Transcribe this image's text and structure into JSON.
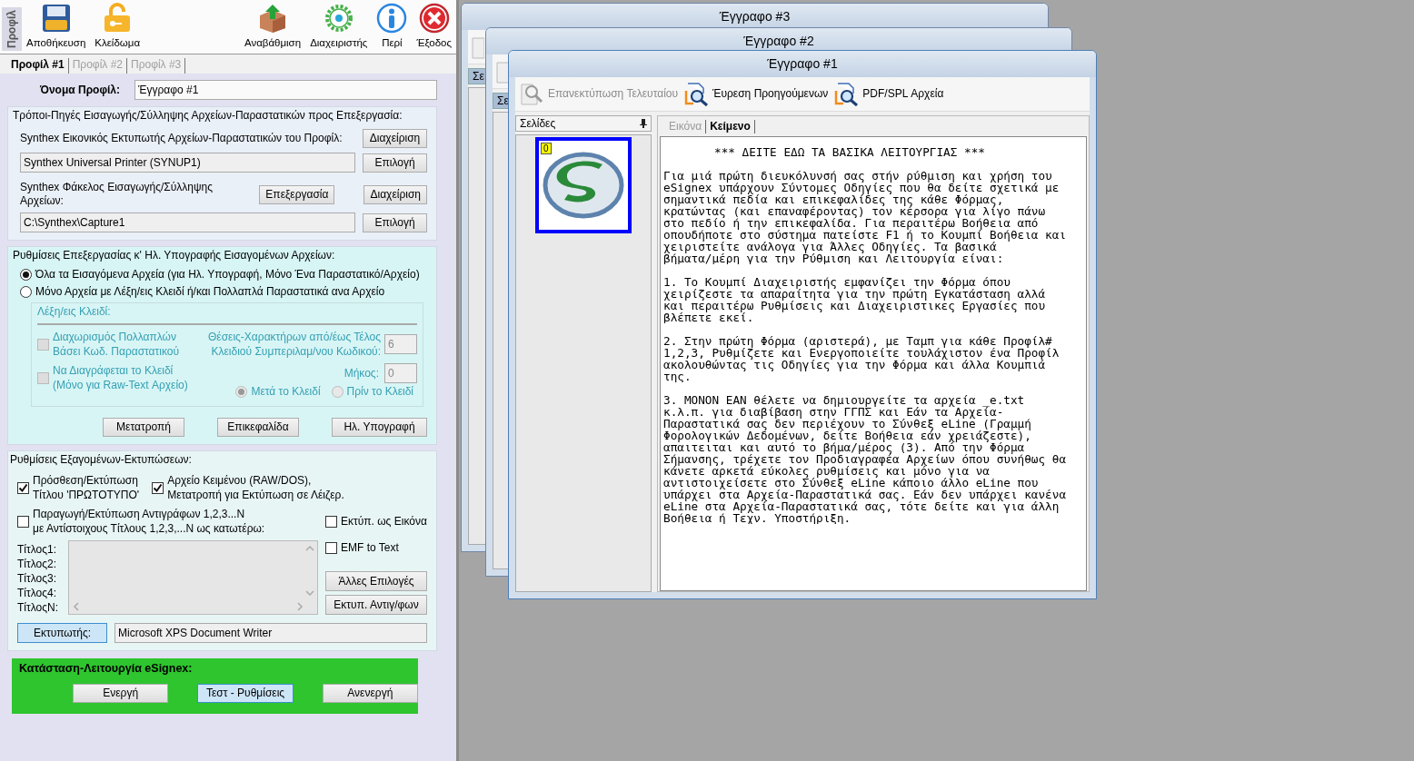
{
  "toolbar": {
    "side_label": "Προφίλ",
    "items": [
      {
        "label": "Αποθήκευση",
        "kind": "save"
      },
      {
        "label": "Κλείδωμα",
        "kind": "unlock"
      },
      {
        "label": "Αναβάθμιση",
        "kind": "update"
      },
      {
        "label": "Διαχειριστής",
        "kind": "admin"
      },
      {
        "label": "Περί",
        "kind": "about"
      },
      {
        "label": "Έξοδος",
        "kind": "exit"
      }
    ]
  },
  "tabs": [
    {
      "label": "Προφίλ #1",
      "selected": true
    },
    {
      "label": "Προφίλ #2",
      "selected": false
    },
    {
      "label": "Προφίλ #3",
      "selected": false
    }
  ],
  "profile_name": {
    "label": "Όνομα Προφίλ:",
    "value": "Έγγραφο  #1"
  },
  "sources": {
    "title": "Τρόποι-Πηγές Εισαγωγής/Σύλληψης Αρχείων-Παραστατικών προς Επεξεργασία:",
    "printer": {
      "label": "Synthex Εικονικός Εκτυπωτής Αρχείων-Παραστατικών του Προφίλ:",
      "manage_button": "Διαχείριση",
      "value": "Synthex Universal Printer (SYNUP1)",
      "select_button": "Επιλογή"
    },
    "folder": {
      "label": "Synthex Φάκελος Εισαγωγής/Σύλληψης Αρχείων:",
      "edit_button": "Επεξεργασία",
      "manage_button": "Διαχείριση",
      "value": "C:\\Synthex\\Capture1",
      "select_button": "Επιλογή"
    }
  },
  "processing": {
    "title": "Ρυθμίσεις Επεξεργασίας κ' Ηλ. Υπογραφής Εισαγομένων Αρχείων:",
    "modes": [
      {
        "label": "Όλα τα Εισαγόμενα Αρχεία (για Ηλ. Υπογραφή, Μόνο Ένα Παραστατικό/Αρχείο)",
        "selected": true
      },
      {
        "label": "Μόνο Αρχεία με Λέξη/εις Κλειδί ή/και Πολλαπλά Παραστατικά ανα Αρχείο",
        "selected": false
      }
    ],
    "keywords": {
      "title": "Λέξη/εις Κλειδί:",
      "disabled": true,
      "split_option": {
        "label_lines": [
          "Διαχωρισμός Πολλαπλών",
          "Βάσει Κωδ. Παραστατικού"
        ],
        "checked": false
      },
      "positions_label_lines": [
        "Θέσεις-Χαρακτήρων από/έως Τέλος",
        "Κλειδιού Συμπεριλαμ/νου Κωδικού:"
      ],
      "positions_value": "6",
      "delete_option": {
        "label_lines": [
          "Να Διαγράφεται το Κλειδί",
          "(Μόνο για Raw-Text Αρχείο)"
        ],
        "checked": false
      },
      "length_label": "Μήκος:",
      "length_value": "0",
      "placement": [
        {
          "label": "Μετά το Κλειδί",
          "selected": true
        },
        {
          "label": "Πρίν το Κλειδί",
          "selected": false
        }
      ]
    },
    "buttons": [
      "Μετατροπή",
      "Επικεφαλίδα",
      "Ηλ. Υπογραφή"
    ]
  },
  "output": {
    "title": "Ρυθμίσεις Εξαγομένων-Εκτυπώσεων:",
    "options": [
      {
        "label_lines": [
          "Πρόσθεση/Εκτύπωση",
          "Τίτλου 'ΠΡΩΤΟΤΥΠΟ'"
        ],
        "checked": true
      },
      {
        "label_lines": [
          "Αρχείο Κειμένου (RAW/DOS),",
          "Μετατροπή για Εκτύπωση  σε Λέιζερ."
        ],
        "checked": true
      },
      {
        "label_lines": [
          "Παραγωγή/Εκτύπωση  Αντιγράφων 1,2,3...N",
          "με Αντίστοιχους Τίτλους  1,2,3,...N ως κατωτέρω:"
        ],
        "checked": false
      },
      {
        "label_lines": [
          "Εκτύπ. ως Εικόνα"
        ],
        "checked": false
      },
      {
        "label_lines": [
          "EMF to Text"
        ],
        "checked": false
      }
    ],
    "title_labels": [
      "Τίτλος1:",
      "Τίτλος2:",
      "Τίτλος3:",
      "Τίτλος4:",
      "ΤίτλοςN:"
    ],
    "side_buttons": [
      "Άλλες Επιλογές",
      "Εκτυπ. Αντιγ/φων"
    ],
    "printer_button": "Εκτυπωτής:",
    "printer_value": "Microsoft XPS Document Writer"
  },
  "status": {
    "title": "Κατάσταση-Λειτουργία eSignex:",
    "buttons": [
      {
        "label": "Ενεργή",
        "selected": false
      },
      {
        "label": "Τεστ - Ρυθμίσεις",
        "selected": true
      },
      {
        "label": "Ανενεργή",
        "selected": false
      }
    ]
  },
  "windows": [
    {
      "title": "Έγγραφο  #3",
      "pages_title": "Σε"
    },
    {
      "title": "Έγγραφο  #2",
      "pages_title": "Σε"
    },
    {
      "title": "Έγγραφο  #1",
      "pages_title": "Σελίδες",
      "toolbar": [
        {
          "label": "Επανεκτύπωση Τελευταίου",
          "kind": "reprint",
          "disabled": true
        },
        {
          "label": "Έυρεση Προηγούμενων",
          "kind": "find",
          "disabled": false
        },
        {
          "label": "PDF/SPL Αρχεία",
          "kind": "files",
          "disabled": false
        }
      ],
      "page_badge": "0",
      "view_tabs": [
        {
          "label": "Εικόνα",
          "selected": false
        },
        {
          "label": "Κείμενο",
          "selected": true
        }
      ],
      "document": {
        "heading": "*** ΔΕΙΤΕ ΕΔΩ ΤΑ ΒΑΣΙΚΑ ΛΕΙΤΟΥΡΓΙΑΣ ***",
        "paragraphs": [
          [
            "Για μιά πρώτη διευκόλυνσή σας στήν ρύθμιση και χρήση του",
            "eSignex υπάρχουν Σύντομες Οδηγίες που θα δείτε σχετικά με",
            "σημαντικά πεδία και επικεφαλίδες της κάθε Φόρμας,",
            "κρατώντας (και επαναφέροντας) τον κέρσορα για λίγο πάνω",
            "στο πεδίο ή την επικεφαλίδα. Για περαιτέρω Βοήθεια από",
            "οπουδήποτε στο σύστημα πατείστε F1 ή το Κουμπί Βοήθεια και",
            "χειριστείτε ανάλογα για Άλλες Οδηγίες. Τα βασικά",
            "βήματα/μέρη για την Ρύθμιση και Λειτουργία είναι:"
          ],
          [
            "1. Το Κουμπί Διαχειριστής εμφανίζει την Φόρμα όπου",
            "χειρίζεστε τα απαραίτητα για την πρώτη Εγκατάσταση αλλά",
            "και περαιτέρω Ρυθμίσεις και Διαχειριστικες Εργασίες που",
            "βλέπετε εκεί."
          ],
          [
            "2. Στην πρώτη Φόρμα (αριστερά), με Ταμπ για κάθε Προφίλ#",
            "1,2,3, Ρυθμίζετε και Ενεργοποιείτε τουλάχιστον ένα Προφίλ",
            "ακολουθώντας τις Οδηγίες για την Φόρμα και άλλα Κουμπιά",
            "της."
          ],
          [
            "3. ΜΟΝΟΝ ΕΑΝ θέλετε να δημιουργείτε τα αρχεία _e.txt",
            "κ.λ.π. για διαβίβαση στην ΓΓΠΣ και Εάν τα Αρχεία-",
            "Παραστατικά σας δεν περιέχουν το Σύνθεξ eLine (Γραμμή",
            "Φορολογικών Δεδομένων, δείτε Βοήθεια εάν χρειάζεστε),",
            "απαιτειται και αυτό το βήμα/μέρος (3). Από την Φόρμα",
            "Σήμανσης, τρέχετε τον Προδιαγραφέα Αρχείων όπου συνήθως θα",
            "κάνετε αρκετά εύκολες ρυθμίσεις και μόνο για να",
            "αντιστοιχείσετε στο Σύνθεξ eLine κάποιο άλλο eLine που",
            "υπάρχει στα Αρχεία-Παραστατικά σας. Εάν δεν υπάρχει κανένα",
            "eLine στα Αρχεία-Παραστατικά σας, τότε δείτε και για άλλη",
            "Βοήθεια ή Τεχν. Υποστήριξη."
          ]
        ]
      }
    }
  ]
}
